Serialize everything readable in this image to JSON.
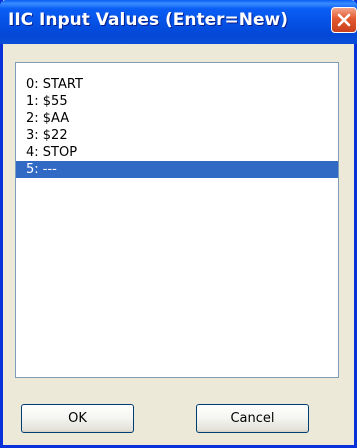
{
  "window": {
    "title": "IIC Input Values (Enter=New)",
    "close_icon": "close-icon"
  },
  "list": {
    "items": [
      {
        "label": "0: START",
        "selected": false
      },
      {
        "label": "1: $55",
        "selected": false
      },
      {
        "label": "2: $AA",
        "selected": false
      },
      {
        "label": "3: $22",
        "selected": false
      },
      {
        "label": "4: STOP",
        "selected": false
      },
      {
        "label": "5: ---",
        "selected": true
      }
    ],
    "selection_color": "#316ac5"
  },
  "buttons": {
    "ok_label": "OK",
    "cancel_label": "Cancel"
  },
  "colors": {
    "titlebar": "#0552e6",
    "close_button": "#e2582f",
    "dialog_background": "#ece9d8"
  }
}
